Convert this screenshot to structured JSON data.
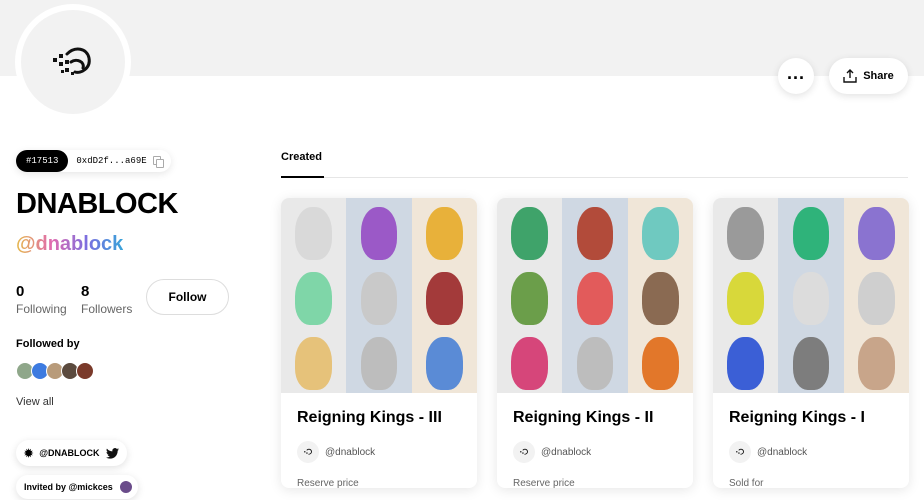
{
  "profile": {
    "token_id": "#17513",
    "address": "0xdD2f...a69E",
    "name": "DNABLOCK",
    "handle": "@dnablock",
    "following_count": "0",
    "following_label": "Following",
    "followers_count": "8",
    "followers_label": "Followers",
    "follow_label": "Follow",
    "followed_by_label": "Followed by",
    "view_all_label": "View all",
    "twitter_handle": "@DNABLOCK",
    "invited_by": "Invited by @mickces"
  },
  "actions": {
    "more_label": "...",
    "share_label": "Share"
  },
  "tabs": {
    "created_label": "Created"
  },
  "cards": [
    {
      "title": "Reigning Kings - III",
      "creator": "@dnablock",
      "footer": "Reserve price",
      "tiles": [
        "#d9d9d9",
        "#9b59c7",
        "#e8b13a",
        "#7fd6a8",
        "#c9c9c9",
        "#a33a3a",
        "#e6c27a",
        "#bdbdbd",
        "#5a8bd6"
      ]
    },
    {
      "title": "Reigning Kings - II",
      "creator": "@dnablock",
      "footer": "Reserve price",
      "tiles": [
        "#3fa36a",
        "#b24b3a",
        "#6fc9c0",
        "#6b9e4a",
        "#e25b5b",
        "#8a6a52",
        "#d6467a",
        "#bdbdbd",
        "#e2772a"
      ]
    },
    {
      "title": "Reigning Kings - I",
      "creator": "@dnablock",
      "footer": "Sold for",
      "tiles": [
        "#9a9a9a",
        "#2fb37a",
        "#8a73d0",
        "#d8d83a",
        "#dcdcdc",
        "#cfcfcf",
        "#3b5fd6",
        "#7d7d7d",
        "#c8a58a"
      ]
    }
  ],
  "icons": {
    "logo": "dnablock-logo-icon",
    "share": "share-icon",
    "copy": "copy-icon",
    "gear": "gear-icon",
    "twitter": "twitter-icon"
  }
}
